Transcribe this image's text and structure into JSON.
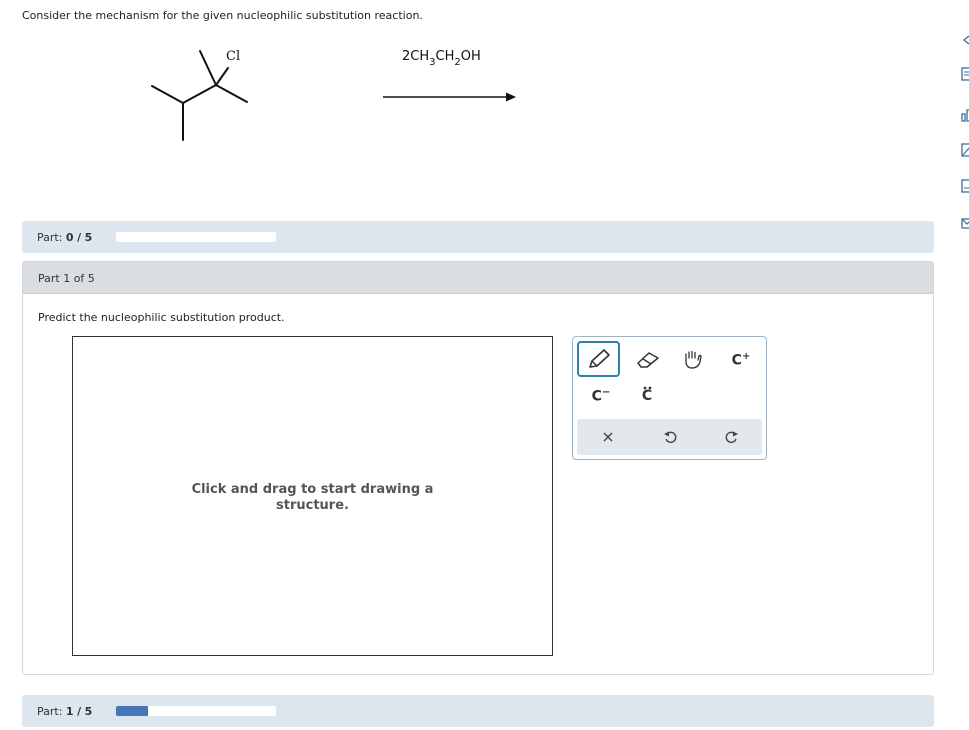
{
  "question": {
    "text": "Consider the mechanism for the given nucleophilic substitution reaction."
  },
  "reaction": {
    "substituent_label": "Cl",
    "reagent_parts": [
      "2CH",
      "3",
      "CH",
      "2",
      "OH"
    ]
  },
  "progress_top": {
    "label": "Part:",
    "completed": "0",
    "separator": "/",
    "total": "5",
    "fraction": 0
  },
  "part": {
    "header": "Part 1 of 5",
    "prompt": "Predict the nucleophilic substitution product.",
    "canvas_hint": "Click and drag to start drawing a structure."
  },
  "toolbar": {
    "icons": [
      "pencil-icon",
      "eraser-icon",
      "hand-icon",
      "carbocation-icon",
      "carbanion-icon",
      "lone-pair-icon",
      "close-icon",
      "undo-icon",
      "redo-icon"
    ],
    "labels": {
      "carbocation_base": "C",
      "carbocation_sup": "+",
      "carbanion_base": "C",
      "carbanion_sup": "−",
      "lone_pair_base": "C"
    }
  },
  "progress_bottom": {
    "label": "Part:",
    "completed": "1",
    "separator": "/",
    "total": "5",
    "fraction": 0.2
  },
  "colors": {
    "accent": "#2e7fa9",
    "progress_fill": "#4576b5",
    "panel_bg": "#dde6ee",
    "header_bg": "#d9dee3"
  }
}
